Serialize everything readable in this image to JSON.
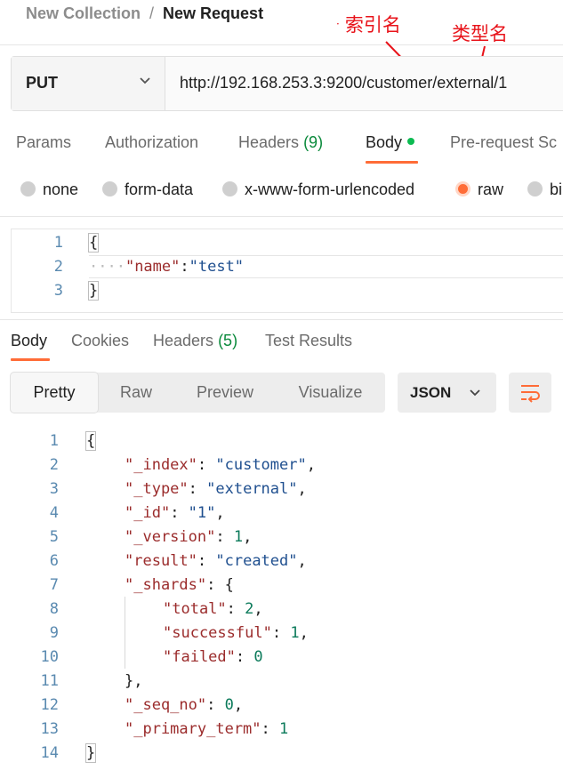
{
  "breadcrumb": {
    "parent": "New Collection",
    "separator": "/",
    "current": "New Request"
  },
  "annotations": {
    "index_name": "索引名",
    "type_name": "类型名",
    "color": "#e8131a"
  },
  "request": {
    "method": "PUT",
    "url": "http://192.168.253.3:9200/customer/external/1"
  },
  "request_tabs": [
    {
      "label": "Params"
    },
    {
      "label": "Authorization"
    },
    {
      "label": "Headers",
      "count": "(9)"
    },
    {
      "label": "Body",
      "active": true
    },
    {
      "label": "Pre-request Sc"
    }
  ],
  "body_types": [
    {
      "label": "none"
    },
    {
      "label": "form-data"
    },
    {
      "label": "x-www-form-urlencoded"
    },
    {
      "label": "raw",
      "selected": true
    },
    {
      "label": "bi"
    }
  ],
  "request_body": {
    "line_numbers": [
      "1",
      "2",
      "3"
    ],
    "lines": {
      "l1": "{",
      "l2_indent": "····",
      "l2_key": "\"name\"",
      "l2_colon": ":",
      "l2_value": "\"test\"",
      "l3": "}"
    }
  },
  "response_tabs": [
    {
      "label": "Body",
      "active": true
    },
    {
      "label": "Cookies"
    },
    {
      "label": "Headers",
      "count": "(5)"
    },
    {
      "label": "Test Results"
    }
  ],
  "view_modes": [
    {
      "label": "Pretty",
      "active": true
    },
    {
      "label": "Raw"
    },
    {
      "label": "Preview"
    },
    {
      "label": "Visualize"
    }
  ],
  "format_select": {
    "value": "JSON"
  },
  "wrap_icon": "wrap-lines-icon",
  "accent_color": "#ff6c37",
  "response_body": {
    "line_numbers": [
      "1",
      "2",
      "3",
      "4",
      "5",
      "6",
      "7",
      "8",
      "9",
      "10",
      "11",
      "12",
      "13",
      "14"
    ],
    "lines": {
      "l1": "{",
      "l2_key": "\"_index\"",
      "l2_value": "\"customer\"",
      "l3_key": "\"_type\"",
      "l3_value": "\"external\"",
      "l4_key": "\"_id\"",
      "l4_value": "\"1\"",
      "l5_key": "\"_version\"",
      "l5_value": "1",
      "l6_key": "\"result\"",
      "l6_value": "\"created\"",
      "l7_key": "\"_shards\"",
      "l7_value": "{",
      "l8_key": "\"total\"",
      "l8_value": "2",
      "l9_key": "\"successful\"",
      "l9_value": "1",
      "l10_key": "\"failed\"",
      "l10_value": "0",
      "l11": "},",
      "l12_key": "\"_seq_no\"",
      "l12_value": "0",
      "l13_key": "\"_primary_term\"",
      "l13_value": "1",
      "l14": "}"
    }
  }
}
